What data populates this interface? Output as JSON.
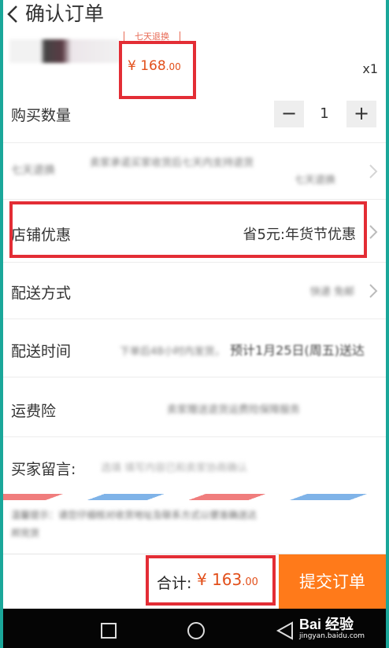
{
  "header": {
    "title": "确认订单"
  },
  "product": {
    "badge_text": "七天退换",
    "price_main": "¥ 168",
    "price_decimal": ".00",
    "quantity_text": "x1"
  },
  "rows": {
    "quantity": {
      "label": "购买数量",
      "minus": "−",
      "value": "1",
      "plus": "+"
    },
    "blurred_info": {
      "label": "七天退换",
      "value_line1": "卖家承诺买家收货后七天内支持退货",
      "value_line2": "七天退换"
    },
    "shop_discount": {
      "label": "店铺优惠",
      "value": "省5元:年货节优惠"
    },
    "delivery_method": {
      "label": "配送方式",
      "value": "快递 免邮"
    },
    "delivery_time": {
      "label": "配送时间",
      "value_blur": "下单后48小时内发货，",
      "value": "预计1月25日(周五)送达"
    },
    "freight_insurance": {
      "label": "运费险",
      "value": "卖家赠送退货运费险保障服务"
    },
    "buyer_message": {
      "label": "买家留言:",
      "placeholder": "选填 填写内容已和卖家协商确认"
    }
  },
  "notice": {
    "line1": "温馨提示：请您仔细核对收货地址及联系方式以便准确送达",
    "line2": "邦完货"
  },
  "footer": {
    "total_label": "合计:",
    "total_main": "¥ 163",
    "total_decimal": ".00",
    "submit_label": "提交订单"
  },
  "watermark": {
    "main": "Bai 经验",
    "sub": "jingyan.baidu.com"
  },
  "colors": {
    "accent": "#ff7a1a",
    "price": "#e24f1a",
    "highlight": "#e32d35",
    "frame": "#1aa79a"
  }
}
